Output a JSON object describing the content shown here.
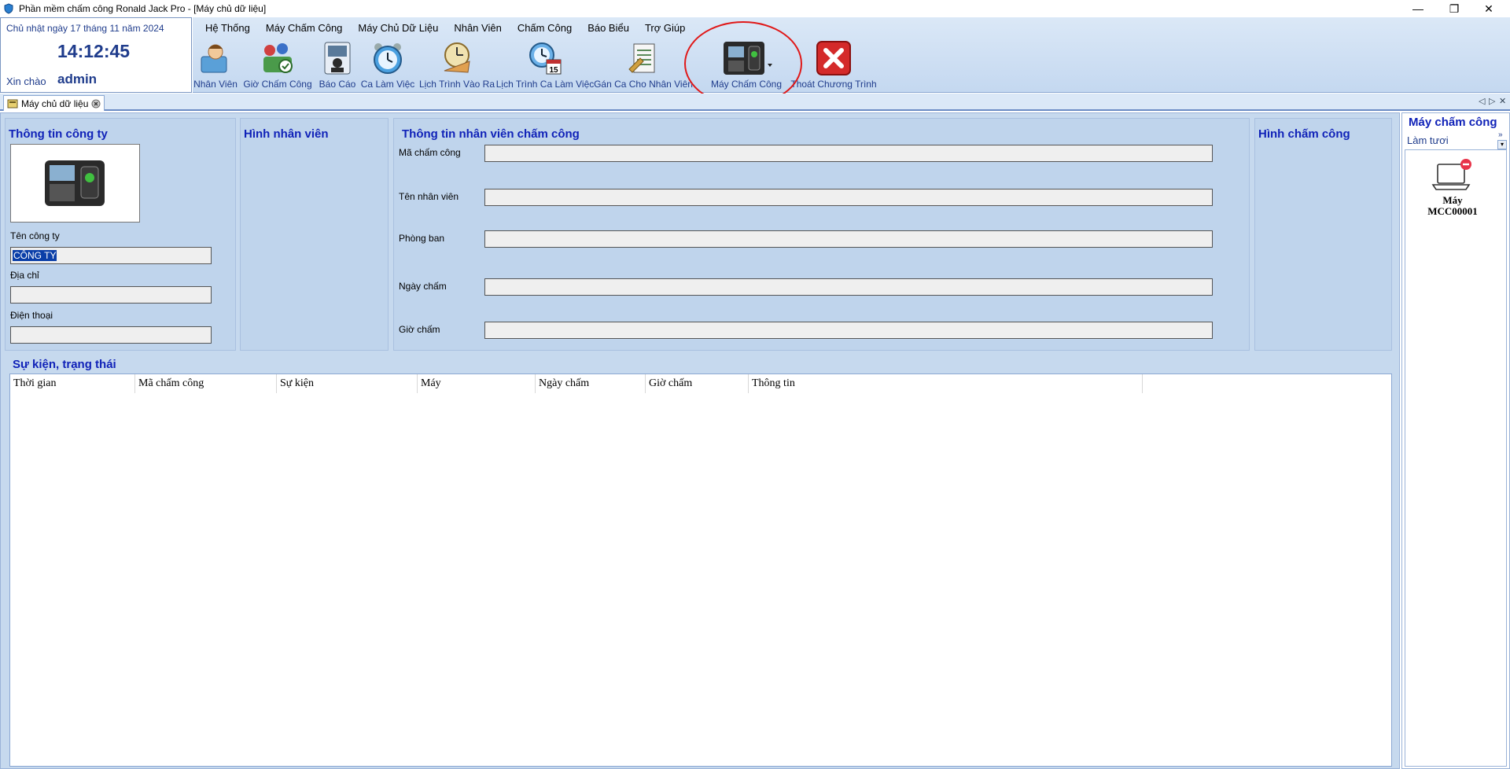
{
  "window": {
    "title": "Phần mềm chấm công Ronald Jack Pro - [Máy chủ dữ liệu]",
    "minimize": "—",
    "restore": "❐",
    "close": "✕"
  },
  "datebox": {
    "date": "Chủ nhật ngày 17 tháng 11 năm 2024",
    "clock": "14:12:45",
    "greeting": "Xin chào",
    "user": "admin"
  },
  "menu": [
    "Hệ Thống",
    "Máy Chấm Công",
    "Máy Chủ Dữ Liệu",
    "Nhân Viên",
    "Chấm Công",
    "Báo Biểu",
    "Trợ Giúp"
  ],
  "toolbar": [
    {
      "label": "Nhân Viên",
      "icon": "employee-icon"
    },
    {
      "label": "Giờ Chấm Công",
      "icon": "attendance-time-icon"
    },
    {
      "label": "Báo Cáo",
      "icon": "report-icon"
    },
    {
      "label": "Ca Làm Việc",
      "icon": "alarm-clock-icon"
    },
    {
      "label": "Lịch Trình Vào Ra",
      "icon": "schedule-icon"
    },
    {
      "label": "Lịch Trình Ca Làm Việc",
      "icon": "calendar-clock-icon"
    },
    {
      "label": "Gán Ca Cho Nhân Viên",
      "icon": "assign-shift-icon"
    },
    {
      "label": "Máy Chấm Công",
      "icon": "attendance-machine-icon"
    },
    {
      "label": "Thoát Chương Trình",
      "icon": "exit-icon"
    }
  ],
  "calendar_number": "15",
  "doctab": {
    "label": "Máy chủ dữ liệu"
  },
  "company": {
    "title": "Thông tin công ty",
    "name_label": "Tên công ty",
    "name_value": "CÔNG TY",
    "address_label": "Địa chỉ",
    "address_value": "",
    "phone_label": "Điện thoại",
    "phone_value": ""
  },
  "employee_photo": {
    "title": "Hình nhân viên"
  },
  "attendance_info": {
    "title": "Thông tin nhân viên chấm công",
    "fields": [
      {
        "label": "Mã chấm công",
        "value": ""
      },
      {
        "label": "Tên nhân viên",
        "value": ""
      },
      {
        "label": "Phòng ban",
        "value": ""
      },
      {
        "label": "Ngày chấm",
        "value": ""
      },
      {
        "label": "Giờ chấm",
        "value": ""
      }
    ]
  },
  "attendance_photo": {
    "title": "Hình chấm công"
  },
  "events": {
    "title": "Sự kiện, trạng thái",
    "columns": [
      "Thời gian",
      "Mã chấm công",
      "Sự kiện",
      "Máy",
      "Ngày chấm",
      "Giờ chấm",
      "Thông tin"
    ]
  },
  "machines_panel": {
    "title": "Máy chấm công",
    "refresh": "Làm tươi",
    "devices": [
      {
        "name_line1": "Máy",
        "name_line2": "MCC00001",
        "status_color": "#e8344a"
      }
    ]
  },
  "colors": {
    "accent": "#1022b8",
    "highlight_circle": "#e01818",
    "exit": "#d42a2a"
  }
}
